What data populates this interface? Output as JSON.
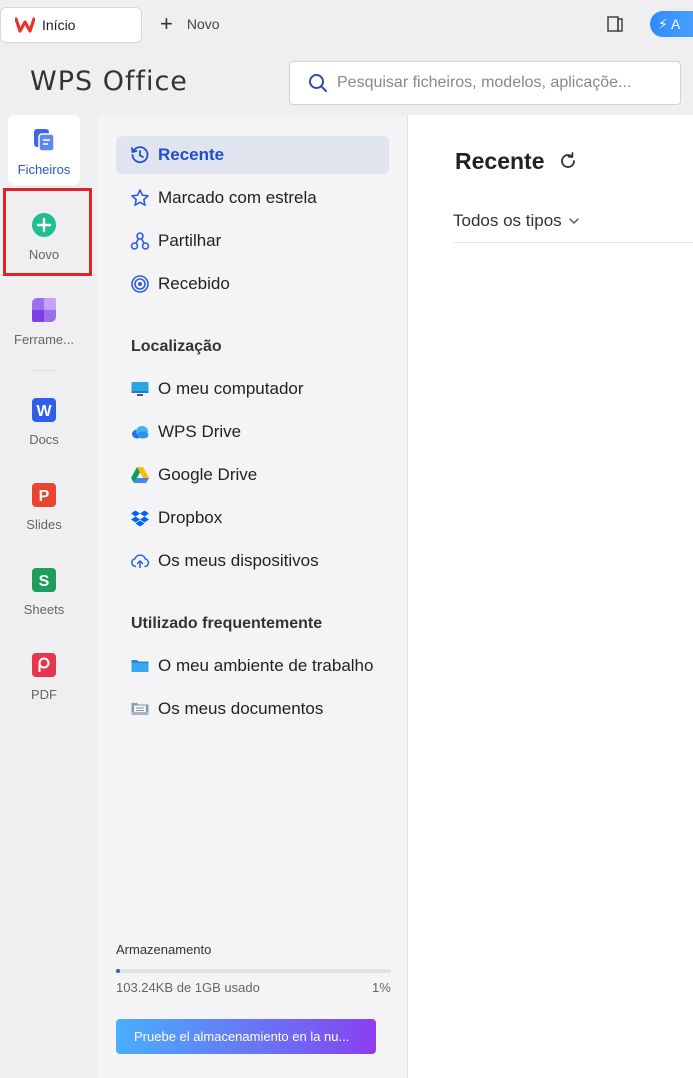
{
  "tabs": {
    "home_label": "Início",
    "new_label": "Novo",
    "upgrade_label": "A"
  },
  "brand": {
    "name": "WPS Office"
  },
  "search": {
    "placeholder": "Pesquisar ficheiros, modelos, aplicaçõe..."
  },
  "rail": {
    "items": [
      {
        "label": "Ficheiros",
        "icon": "files-icon",
        "active": true
      },
      {
        "label": "Novo",
        "icon": "plus-circle-icon",
        "highlighted": true
      },
      {
        "label": "Ferrame...",
        "icon": "tools-icon"
      },
      {
        "label": "Docs",
        "icon": "docs-icon"
      },
      {
        "label": "Slides",
        "icon": "slides-icon"
      },
      {
        "label": "Sheets",
        "icon": "sheets-icon"
      },
      {
        "label": "PDF",
        "icon": "pdf-icon"
      }
    ]
  },
  "nav": {
    "items": [
      {
        "label": "Recente",
        "icon": "recent-icon",
        "active": true
      },
      {
        "label": "Marcado com estrela",
        "icon": "star-icon"
      },
      {
        "label": "Partilhar",
        "icon": "share-icon"
      },
      {
        "label": "Recebido",
        "icon": "received-icon"
      }
    ],
    "location_heading": "Localização",
    "locations": [
      {
        "label": "O meu computador",
        "icon": "computer-icon"
      },
      {
        "label": "WPS Drive",
        "icon": "wps-drive-icon"
      },
      {
        "label": "Google Drive",
        "icon": "google-drive-icon"
      },
      {
        "label": "Dropbox",
        "icon": "dropbox-icon"
      },
      {
        "label": "Os meus dispositivos",
        "icon": "devices-icon"
      }
    ],
    "frequent_heading": "Utilizado frequentemente",
    "frequent": [
      {
        "label": "O meu ambiente de trabalho",
        "icon": "desktop-folder-icon"
      },
      {
        "label": "Os meus documentos",
        "icon": "documents-folder-icon"
      }
    ]
  },
  "storage": {
    "label": "Armazenamento",
    "used_text": "103.24KB de 1GB usado",
    "percent_text": "1%",
    "percent": 1,
    "cta": "Pruebe el almacenamiento en la nu..."
  },
  "main": {
    "title": "Recente",
    "filter_label": "Todos os tipos"
  },
  "colors": {
    "accent": "#1f4fd0",
    "highlight_border": "#e02424",
    "new_icon": "#1fbf8f"
  }
}
